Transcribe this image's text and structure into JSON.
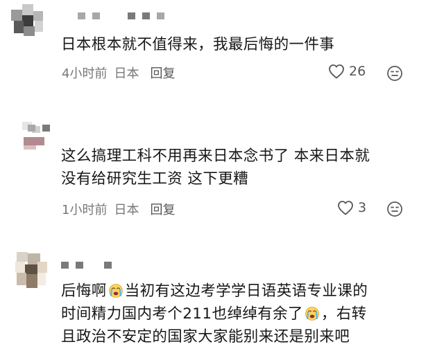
{
  "comments": [
    {
      "text_lines": [
        "日本根本就不值得来，我最后悔的一件事"
      ],
      "time": "4小时前",
      "location": "日本",
      "reply_label": "回复",
      "likes": "26"
    },
    {
      "text_lines": [
        "这么搞理工科不用再来日本念书了 本来日本就",
        "没有给研究生工资 这下更糟"
      ],
      "time": "1小时前",
      "location": "日本",
      "reply_label": "回复",
      "likes": "3"
    },
    {
      "text_parts": {
        "line1_a": "后悔啊",
        "line1_b": "当初有这边考学学日语英语专业课的",
        "line2_a": "时间精力国内考个211也绰绰有余了",
        "line2_b": "，右转",
        "line3": "且政治不安定的国家大家能别来还是别来吧"
      },
      "emoji_icon": "crying-face-icon"
    }
  ],
  "icons": {
    "like": "heart-outline-icon",
    "dislike": "neutral-face-icon"
  },
  "colors": {
    "text": "#171717",
    "meta": "#777777",
    "icon": "#555555"
  }
}
